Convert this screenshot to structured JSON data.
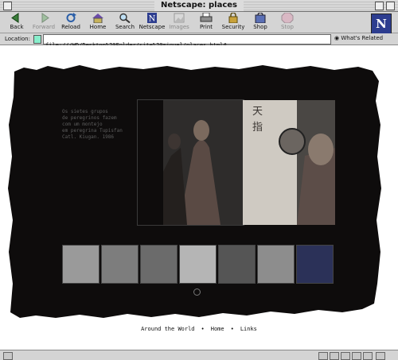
{
  "window": {
    "title": "Netscape: places"
  },
  "toolbar": {
    "buttons": [
      {
        "label": "Back",
        "icon": "back-icon",
        "enabled": true
      },
      {
        "label": "Forward",
        "icon": "forward-icon",
        "enabled": false
      },
      {
        "label": "Reload",
        "icon": "reload-icon",
        "enabled": true
      },
      {
        "label": "Home",
        "icon": "home-icon",
        "enabled": true
      },
      {
        "label": "Search",
        "icon": "search-icon",
        "enabled": true
      },
      {
        "label": "Netscape",
        "icon": "netscape-icon",
        "enabled": true
      },
      {
        "label": "Images",
        "icon": "images-icon",
        "enabled": false
      },
      {
        "label": "Print",
        "icon": "print-icon",
        "enabled": true
      },
      {
        "label": "Security",
        "icon": "security-icon",
        "enabled": true
      },
      {
        "label": "Shop",
        "icon": "shop-icon",
        "enabled": true
      },
      {
        "label": "Stop",
        "icon": "stop-icon",
        "enabled": false
      }
    ],
    "logo": "N"
  },
  "location": {
    "label": "Location:",
    "url": "file:///HD/Desktop%20Folder/site%20miguel/places.html#",
    "whats_related": "What's Related"
  },
  "page": {
    "caption_lines": [
      "Os sietes grupos",
      "de peregrinos fazem",
      "com um montejo",
      "em peregrina Tupisfan",
      "Catl. Kiugan. 1986"
    ],
    "thumbnails": [
      {
        "name": "thumb-1",
        "tone": "#9a9a9a"
      },
      {
        "name": "thumb-2",
        "tone": "#7d7d7d"
      },
      {
        "name": "thumb-3",
        "tone": "#6b6b6b"
      },
      {
        "name": "thumb-4",
        "tone": "#b5b5b5"
      },
      {
        "name": "thumb-5",
        "tone": "#555555"
      },
      {
        "name": "thumb-6",
        "tone": "#8d8d8d"
      },
      {
        "name": "thumb-7",
        "tone": "#2b3158"
      }
    ],
    "footer": {
      "links": [
        "Around the World",
        "Home",
        "Links"
      ],
      "separator": "•"
    }
  },
  "colors": {
    "chrome": "#d4d4d4",
    "page_bg": "#ffffff",
    "panel": "#0e0c0c",
    "netscape_blue": "#2d3d8f"
  }
}
